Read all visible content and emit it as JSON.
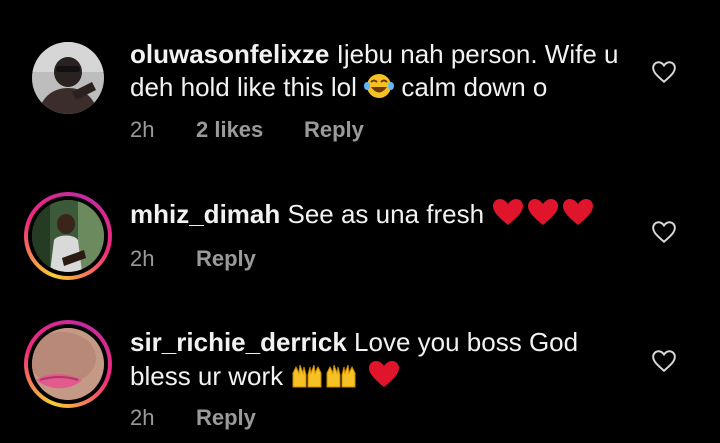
{
  "comments": [
    {
      "username": "oluwasonfelixze",
      "text_part1": "Ijebu nah person. Wife u deh hold like this lol",
      "emoji1": "laughing-tears",
      "text_part2": "calm down o",
      "time": "2h",
      "likes": "2 likes",
      "reply": "Reply"
    },
    {
      "username": "mhiz_dimah",
      "text_part1": "See as una fresh",
      "emoji1": "red-hearts",
      "time": "2h",
      "reply": "Reply"
    },
    {
      "username": "sir_richie_derrick",
      "text_part1": "Love you boss God bless ur work",
      "emoji1": "raising-hands",
      "time": "2h",
      "reply": "Reply"
    }
  ],
  "colors": {
    "background": "#000000",
    "text": "#f2f2f2",
    "meta": "#9a9a9a",
    "heart_red": "#e0152b",
    "emoji_yellow": "#f7c125"
  }
}
